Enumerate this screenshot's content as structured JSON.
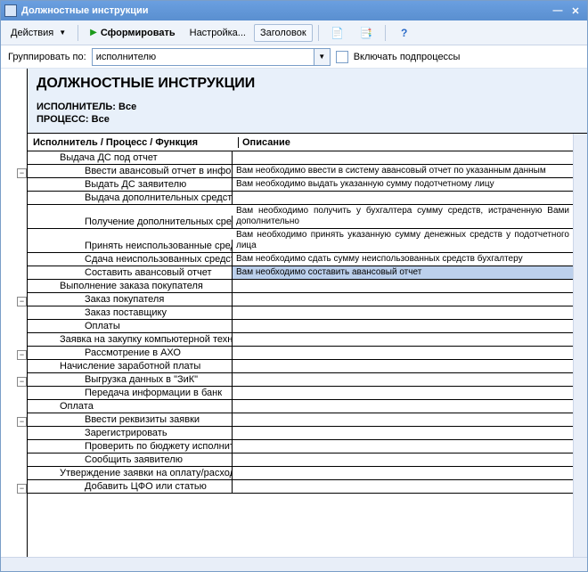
{
  "window": {
    "title": "Должностные инструкции"
  },
  "toolbar": {
    "actions": "Действия",
    "build": "Сформировать",
    "settings": "Настройка...",
    "caption": "Заголовок"
  },
  "filter": {
    "group_label": "Группировать по:",
    "group_value": "исполнителю",
    "sub_label": "Включать подпроцессы"
  },
  "doc": {
    "title": "ДОЛЖНОСТНЫЕ ИНСТРУКЦИИ",
    "meta_executor_label": "ИСПОЛНИТЕЛЬ:",
    "meta_executor_val": "Все",
    "meta_process_label": "ПРОЦЕСС:",
    "meta_process_val": "Все",
    "col_a": "Исполнитель / Процесс / Функция",
    "col_b": "Описание"
  },
  "rows": [
    {
      "a": "Выдача ДС под отчет",
      "b": "",
      "indent": 2,
      "toggle": "−"
    },
    {
      "a": "Ввести авансовый отчет в инфо",
      "b": "Вам необходимо ввести в систему авансовый отчет по указанным данным",
      "indent": 3
    },
    {
      "a": "Выдать ДС заявителю",
      "b": "Вам необходимо выдать указанную сумму подотчетному лицу",
      "indent": 3
    },
    {
      "a": "Выдача дополнительных средств",
      "b": "",
      "indent": 3
    },
    {
      "a": "Получение дополнительных сред",
      "b": "Вам необходимо получить у бухгалтера сумму средств, истраченную Вами дополнительно",
      "indent": 3
    },
    {
      "a": "Принять неиспользованные сред",
      "b": "Вам необходимо принять указанную сумму денежных средств у подотчетного лица",
      "indent": 3
    },
    {
      "a": "Сдача неиспользованных средств",
      "b": "Вам необходимо сдать сумму неиспользованных средств бухгалтеру",
      "indent": 3
    },
    {
      "a": "Составить авансовый отчет",
      "b": "Вам необходимо составить авансовый отчет",
      "indent": 3,
      "sel": true
    },
    {
      "a": "Выполнение заказа покупателя",
      "b": "",
      "indent": 2,
      "toggle": "−"
    },
    {
      "a": "Заказ покупателя",
      "b": "",
      "indent": 3
    },
    {
      "a": "Заказ поставщику",
      "b": "",
      "indent": 3
    },
    {
      "a": "Оплаты",
      "b": "",
      "indent": 3
    },
    {
      "a": "Заявка на закупку компьютерной техни",
      "b": "",
      "indent": 2,
      "toggle": "−"
    },
    {
      "a": "Рассмотрение в АХО",
      "b": "",
      "indent": 3
    },
    {
      "a": "Начисление заработной платы",
      "b": "",
      "indent": 2,
      "toggle": "−"
    },
    {
      "a": "Выгрузка данных в \"ЗиК\"",
      "b": "",
      "indent": 3
    },
    {
      "a": "Передача информации в банк",
      "b": "",
      "indent": 3
    },
    {
      "a": "Оплата",
      "b": "",
      "indent": 2,
      "toggle": "−"
    },
    {
      "a": "Ввести реквизиты заявки",
      "b": "",
      "indent": 3
    },
    {
      "a": "Зарегистрировать",
      "b": "",
      "indent": 3
    },
    {
      "a": "Проверить по бюджету исполнит",
      "b": "",
      "indent": 3
    },
    {
      "a": "Сообщить заявителю",
      "b": "",
      "indent": 3
    },
    {
      "a": "Утверждение заявки на оплату/расход",
      "b": "",
      "indent": 2,
      "toggle": "−"
    },
    {
      "a": "Добавить ЦФО или статью",
      "b": "",
      "indent": 3
    }
  ],
  "chart_data": {
    "type": "table"
  }
}
